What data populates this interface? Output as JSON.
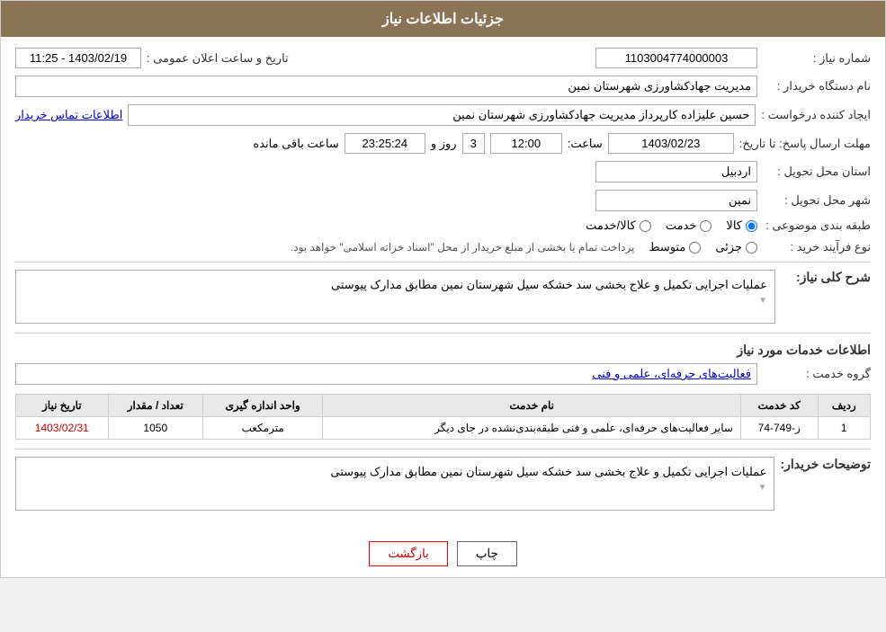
{
  "header": {
    "title": "جزئیات اطلاعات نیاز"
  },
  "fields": {
    "request_number_label": "شماره نیاز :",
    "request_number_value": "1103004774000003",
    "org_name_label": "نام دستگاه خریدار :",
    "org_name_value": "مدیریت جهادکشاورزی شهرستان نمین",
    "requester_label": "ایجاد کننده درخواست :",
    "requester_value": "حسین علیزاده کارپرداز مدیریت جهادکشاورزی شهرستان نمین",
    "contact_link": "اطلاعات تماس خریدار",
    "deadline_label": "مهلت ارسال پاسخ: تا تاریخ:",
    "date_value": "1403/02/23",
    "time_label": "ساعت:",
    "time_value": "12:00",
    "days_label": "روز و",
    "days_value": "3",
    "remaining_label": "ساعت باقی مانده",
    "remaining_value": "23:25:24",
    "announce_datetime_label": "تاریخ و ساعت اعلان عمومی :",
    "announce_datetime_value": "1403/02/19 - 11:25",
    "province_label": "استان محل تحویل :",
    "province_value": "اردبیل",
    "city_label": "شهر محل تحویل :",
    "city_value": "نمین",
    "category_label": "طبقه بندی موضوعی :",
    "category_options": [
      "کالا",
      "خدمت",
      "کالا/خدمت"
    ],
    "category_selected": "کالا",
    "purchase_type_label": "نوع فرآیند خرید :",
    "purchase_options": [
      "جزئی",
      "متوسط"
    ],
    "purchase_note": "پرداخت تمام یا بخشی از مبلغ خریدار از محل \"اسناد خزانه اسلامی\" خواهد بود.",
    "need_description_label": "شرح کلی نیاز:",
    "need_description_value": "عملیات اجرایی تکمیل و علاج بخشی سد خشکه سیل  شهرستان نمین مطابق مدارک پیوستی",
    "services_info_title": "اطلاعات خدمات مورد نیاز",
    "service_group_label": "گروه خدمت :",
    "service_group_value": "فعالیت‌های حرفه‌ای، علمی و فنی"
  },
  "table": {
    "headers": [
      "ردیف",
      "کد خدمت",
      "نام خدمت",
      "واحد اندازه گیری",
      "تعداد / مقدار",
      "تاریخ نیاز"
    ],
    "rows": [
      {
        "row_num": "1",
        "service_code": "ز-749-74",
        "service_name": "سایر فعالیت‌های حرفه‌ای، علمی و فنی طبقه‌بندی‌نشده در جای دیگر",
        "unit": "مترمکعب",
        "quantity": "1050",
        "date": "1403/02/31"
      }
    ]
  },
  "buyer_description_label": "توضیحات خریدار:",
  "buyer_description_value": "عملیات اجرایی تکمیل و علاج بخشی سد خشکه سیل  شهرستان نمین مطابق مدارک پیوستی",
  "buttons": {
    "print": "چاپ",
    "back": "بازگشت"
  }
}
